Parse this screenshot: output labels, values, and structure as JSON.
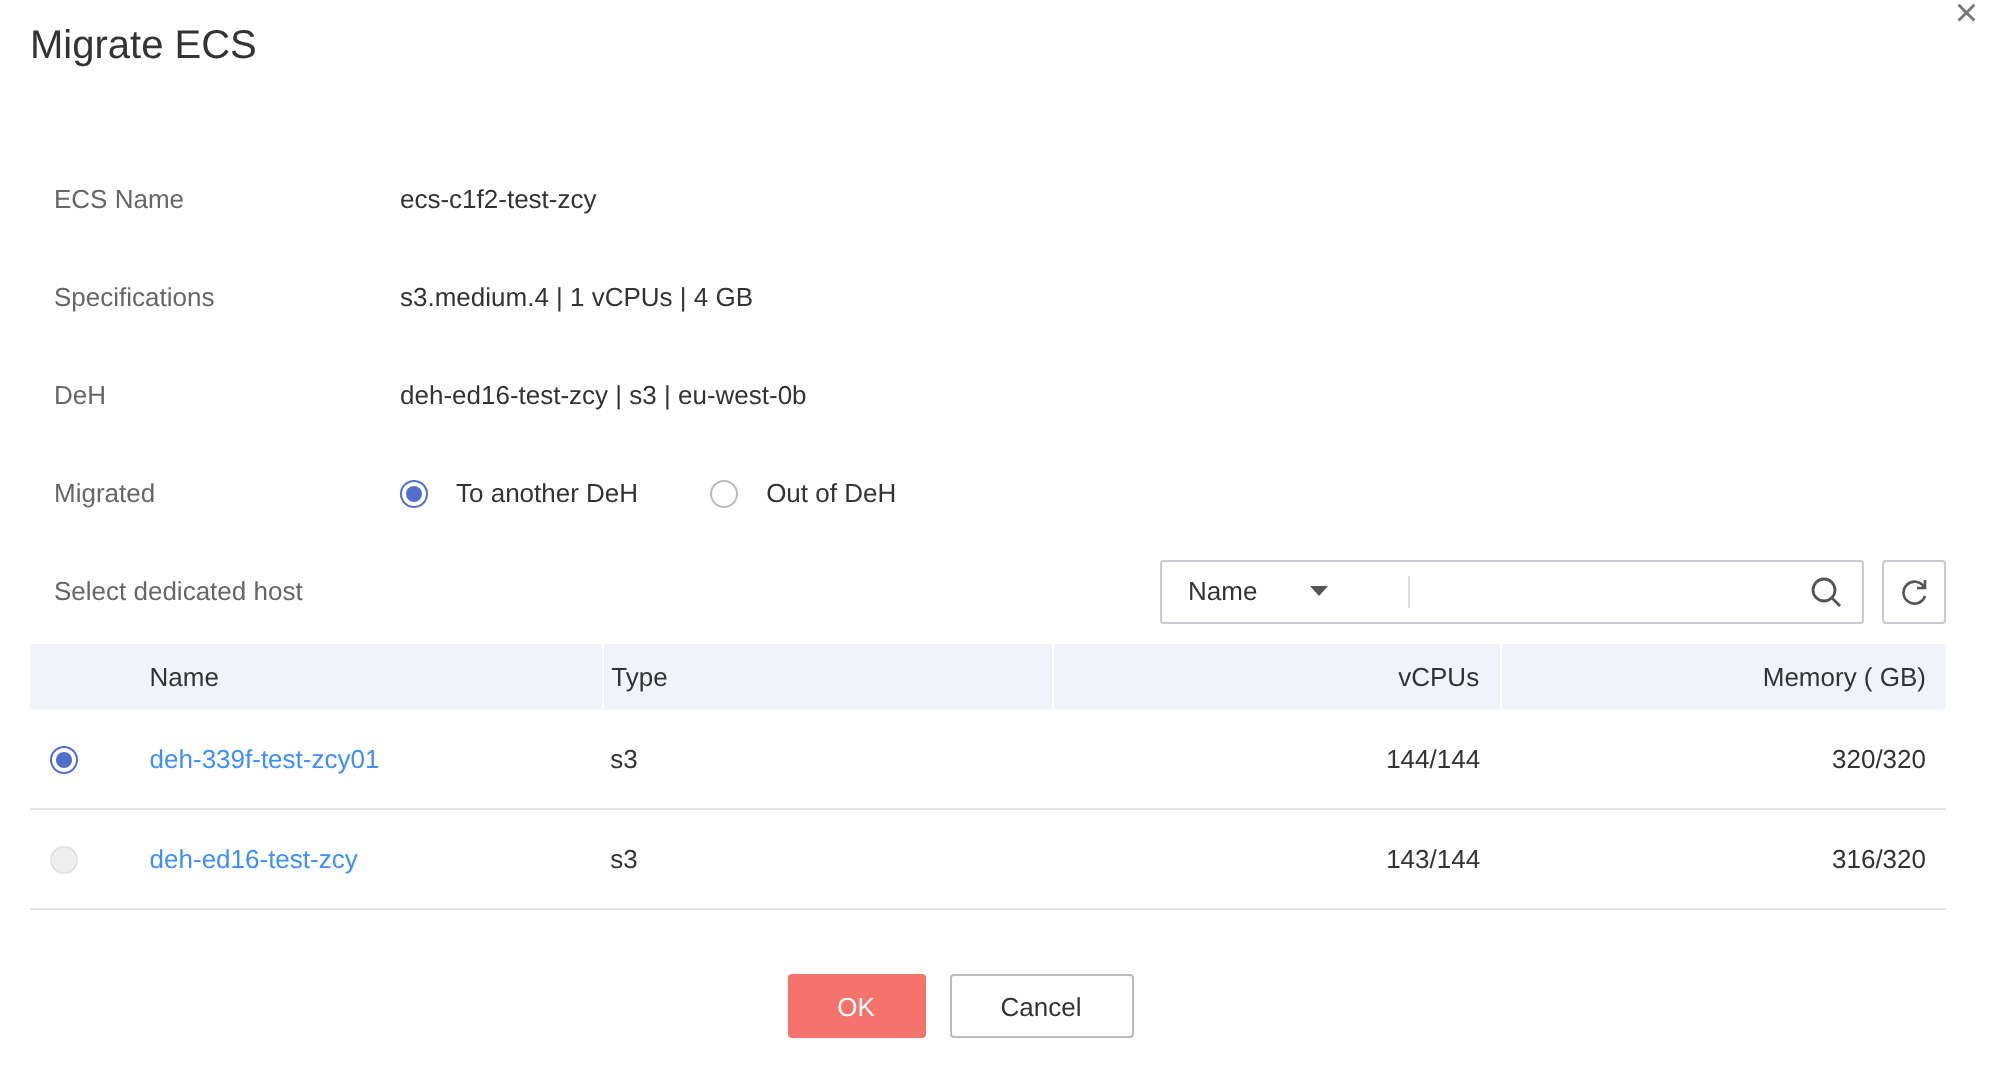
{
  "dialog": {
    "title": "Migrate ECS",
    "close": "×"
  },
  "fields": [
    {
      "label": "ECS Name",
      "value": "ecs-c1f2-test-zcy"
    },
    {
      "label": "Specifications",
      "value": "s3.medium.4 | 1 vCPUs | 4 GB"
    },
    {
      "label": "DeH",
      "value": "deh-ed16-test-zcy | s3 | eu-west-0b"
    }
  ],
  "migrated": {
    "label": "Migrated",
    "options": [
      {
        "label": "To another DeH",
        "selected": true
      },
      {
        "label": "Out of DeH",
        "selected": false
      }
    ]
  },
  "host_select": {
    "label": "Select dedicated host",
    "filter": "Name"
  },
  "table": {
    "columns": [
      "Name",
      "Type",
      "vCPUs",
      "Memory ( GB)"
    ],
    "rows": [
      {
        "name": "deh-339f-test-zcy01",
        "type": "s3",
        "vcpus": "144/144",
        "memory": "320/320",
        "selected": true,
        "disabled": false
      },
      {
        "name": "deh-ed16-test-zcy",
        "type": "s3",
        "vcpus": "143/144",
        "memory": "316/320",
        "selected": false,
        "disabled": true
      }
    ]
  },
  "buttons": [
    {
      "label": "OK",
      "kind": "primary"
    },
    {
      "label": "Cancel",
      "kind": "secondary"
    }
  ]
}
